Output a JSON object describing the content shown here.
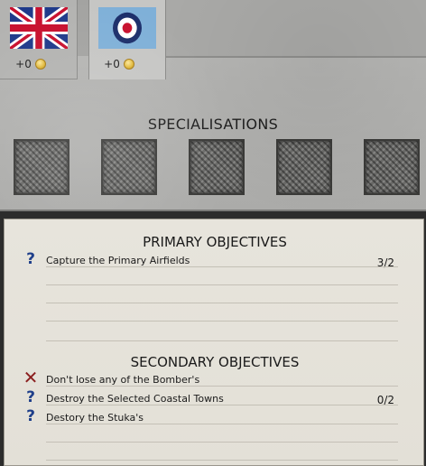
{
  "factions": [
    {
      "name": "uk",
      "income": "+0",
      "icon": "union-jack-flag"
    },
    {
      "name": "raf",
      "income": "+0",
      "icon": "raf-roundel-flag"
    }
  ],
  "specialisations": {
    "title": "SPECIALISATIONS",
    "slots": [
      "empty",
      "empty",
      "empty",
      "empty",
      "empty"
    ]
  },
  "primary": {
    "title": "PRIMARY OBJECTIVES",
    "items": [
      {
        "status": "unknown",
        "icon": "question-icon",
        "text": "Capture the Primary Airfields",
        "count": "3/2"
      }
    ]
  },
  "secondary": {
    "title": "SECONDARY OBJECTIVES",
    "items": [
      {
        "status": "failed",
        "icon": "cross-icon",
        "text": "Don't lose any of the Bomber's",
        "count": ""
      },
      {
        "status": "unknown",
        "icon": "question-icon",
        "text": "Destroy the Selected Coastal Towns",
        "count": "0/2"
      },
      {
        "status": "unknown",
        "icon": "question-icon",
        "text": "Destory the Stuka's",
        "count": ""
      }
    ]
  },
  "colors": {
    "question": "#1f3f8a",
    "cross": "#8a1e1e",
    "coin": "#e0b83a"
  }
}
